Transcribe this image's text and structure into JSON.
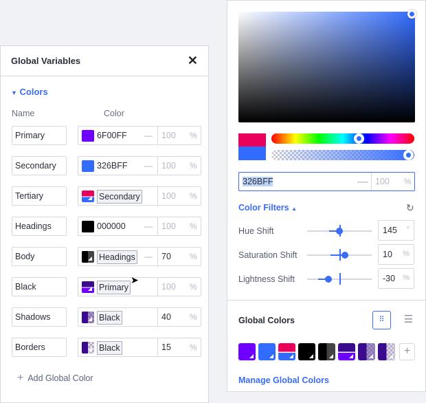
{
  "panel": {
    "title": "Global Variables",
    "section": "Colors",
    "col_name": "Name",
    "col_color": "Color",
    "add_label": "Add Global Color"
  },
  "rows": [
    {
      "name": "Primary",
      "value": "6F00FF",
      "ref": false,
      "opacity": "100"
    },
    {
      "name": "Secondary",
      "value": "326BFF",
      "ref": false,
      "opacity": "100"
    },
    {
      "name": "Tertiary",
      "value": "Secondary",
      "ref": true,
      "opacity": "100"
    },
    {
      "name": "Headings",
      "value": "000000",
      "ref": false,
      "opacity": "100"
    },
    {
      "name": "Body",
      "value": "Headings",
      "ref": true,
      "opacity": "70"
    },
    {
      "name": "Black",
      "value": "Primary",
      "ref": true,
      "opacity": "100"
    },
    {
      "name": "Shadows",
      "value": "Black",
      "ref": true,
      "opacity": "40"
    },
    {
      "name": "Borders",
      "value": "Black",
      "ref": true,
      "opacity": "15"
    }
  ],
  "picker": {
    "hex": "326BFF",
    "opacity": "100",
    "pct": "%",
    "filters_label": "Color Filters",
    "filters": [
      {
        "label": "Hue Shift",
        "value": "145",
        "unit": "°"
      },
      {
        "label": "Saturation Shift",
        "value": "10",
        "unit": "%"
      },
      {
        "label": "Lightness Shift",
        "value": "-30",
        "unit": "%"
      }
    ],
    "global_title": "Global Colors",
    "manage": "Manage Global Colors"
  },
  "colors": {
    "accent": "#3b6cf5",
    "primary": "#6F00FF",
    "secondary": "#326BFF",
    "tertiary": "#E8005A",
    "black": "#3A0A8F"
  }
}
